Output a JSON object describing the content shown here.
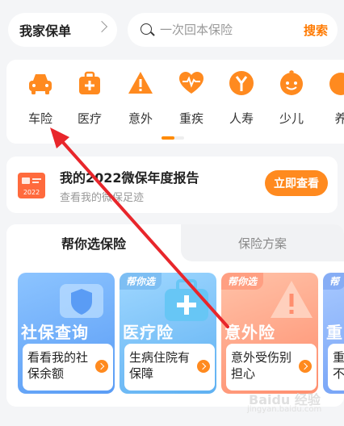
{
  "header": {
    "family_label": "我家保单",
    "search_placeholder": "一次回本保险",
    "search_button": "搜索"
  },
  "categories": [
    {
      "label": "车险",
      "icon": "car-icon"
    },
    {
      "label": "医疗",
      "icon": "medical-kit-icon"
    },
    {
      "label": "意外",
      "icon": "warning-icon"
    },
    {
      "label": "重疾",
      "icon": "heart-pulse-icon"
    },
    {
      "label": "人寿",
      "icon": "coin-tree-icon"
    },
    {
      "label": "少儿",
      "icon": "child-face-icon"
    },
    {
      "label": "养",
      "icon": "elder-icon"
    }
  ],
  "report": {
    "title": "我的2022微保年度报告",
    "subtitle": "查看我的微保足迹",
    "icon_text": "2022",
    "button": "立即查看"
  },
  "picker": {
    "tabs": [
      "帮你选保险",
      "保险方案"
    ],
    "cards": [
      {
        "badge": "",
        "title": "社保查询",
        "desc": "看看我的社保余额",
        "icon": "shield-icon"
      },
      {
        "badge": "帮你选",
        "title": "医疗险",
        "desc": "生病住院有保障",
        "icon": "medical-kit-icon"
      },
      {
        "badge": "帮你选",
        "title": "意外险",
        "desc": "意外受伤别担心",
        "icon": "warning-icon"
      },
      {
        "badge": "帮",
        "title": "重",
        "desc": "重不",
        "icon": "heart-icon"
      }
    ]
  },
  "watermark": {
    "main": "Baidu 经验",
    "sub": "jingyan.baidu.com"
  },
  "colors": {
    "accent": "#ff8a1f",
    "annotation_arrow": "#e8262b"
  }
}
